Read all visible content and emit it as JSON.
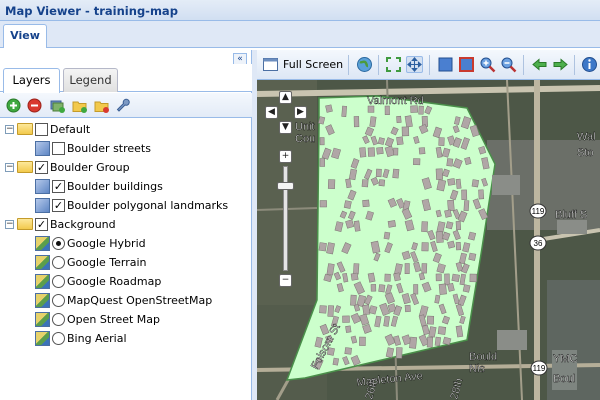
{
  "window": {
    "title": "Map Viewer - training-map"
  },
  "main_tabs": [
    {
      "label": "View"
    }
  ],
  "left_panel": {
    "collapse_glyph": "«",
    "tabs": [
      {
        "label": "Layers",
        "active": true
      },
      {
        "label": "Legend",
        "active": false
      }
    ],
    "toolbar": [
      "add-icon",
      "remove-icon",
      "add-layers-icon",
      "add-group-icon",
      "remove-group-icon",
      "properties-wrench-icon"
    ],
    "tree": [
      {
        "label": "Default",
        "type": "group",
        "checked": false
      },
      {
        "label": "Boulder streets",
        "type": "layer",
        "checked": false
      },
      {
        "label": "Boulder Group",
        "type": "group",
        "checked": true
      },
      {
        "label": "Boulder buildings",
        "type": "layer",
        "checked": true
      },
      {
        "label": "Boulder polygonal landmarks",
        "type": "layer",
        "checked": true
      },
      {
        "label": "Background",
        "type": "group",
        "checked": true
      },
      {
        "label": "Google Hybrid",
        "type": "base",
        "selected": true
      },
      {
        "label": "Google Terrain",
        "type": "base",
        "selected": false
      },
      {
        "label": "Google Roadmap",
        "type": "base",
        "selected": false
      },
      {
        "label": "MapQuest OpenStreetMap",
        "type": "base",
        "selected": false
      },
      {
        "label": "Open Street Map",
        "type": "base",
        "selected": false
      },
      {
        "label": "Bing Aerial",
        "type": "base",
        "selected": false
      }
    ]
  },
  "map_toolbar": {
    "full_screen_label": "Full Screen",
    "buttons": [
      "full-screen-icon",
      "globe-icon",
      "zoom-extent-icon",
      "pan-icon",
      "zoom-box-icon",
      "zoom-full-icon",
      "zoom-in-icon",
      "zoom-out-icon",
      "back-arrow-icon",
      "forward-arrow-icon",
      "info-icon"
    ]
  },
  "map": {
    "labels": [
      "Valmont Rd",
      "Unit",
      "Cou",
      "Wal",
      "Sto",
      "Bluff S",
      "Folsom St",
      "Mapleton Ave",
      "Bould",
      "Nis",
      "YMC",
      "Boul",
      "26th",
      "28th"
    ],
    "shields": [
      "119",
      "36",
      "119"
    ],
    "colors": {
      "landmark_fill": "#ccffcc",
      "landmark_stroke": "#4a8f4a",
      "building": "#b0a6a6"
    }
  }
}
